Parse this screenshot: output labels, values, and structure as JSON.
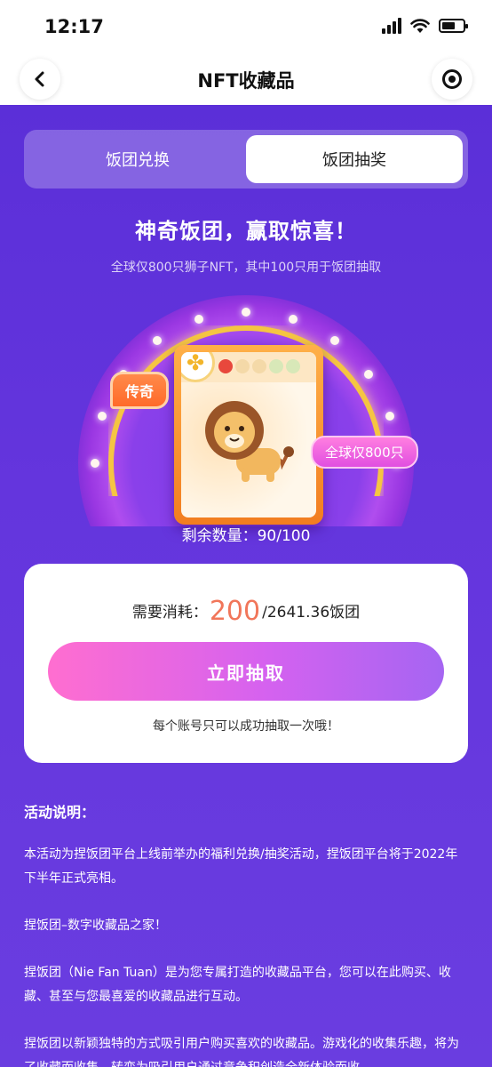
{
  "status": {
    "time": "12:17"
  },
  "nav": {
    "title": "NFT收藏品"
  },
  "tabs": [
    {
      "label": "饭团兑换",
      "active": false
    },
    {
      "label": "饭团抽奖",
      "active": true
    }
  ],
  "headline": "神奇饭团，赢取惊喜！",
  "subline": "全球仅800只狮子NFT，其中100只用于饭团抽取",
  "badges": {
    "rarity": "传奇",
    "limit": "全球仅800只"
  },
  "remaining": {
    "label": "剩余数量：",
    "value": "90/100"
  },
  "cost": {
    "label": "需要消耗：",
    "value": "200",
    "balance": "/2641.36饭团"
  },
  "draw_button": "立即抽取",
  "draw_note": "每个账号只可以成功抽取一次哦！",
  "description": {
    "title": "活动说明：",
    "paragraphs": [
      "本活动为捏饭团平台上线前举办的福利兑换/抽奖活动，捏饭团平台将于2022年下半年正式亮相。",
      "捏饭团–数字收藏品之家！",
      "捏饭团（Nie Fan Tuan）是为您专属打造的收藏品平台，您可以在此购买、收藏、甚至与您最喜爱的收藏品进行互动。",
      "捏饭团以新颖独特的方式吸引用户购买喜欢的收藏品。游戏化的收集乐趣，将为了收藏而收集，转变为吸引用户通过竞争积创造全新体验而收"
    ]
  },
  "colors": {
    "background": "#5a2fd6",
    "accent_pink": "#ff6ed0",
    "cost_value": "#f1765a",
    "card_orange": "#f27d20"
  },
  "icons": [
    "back-arrow-icon",
    "target-icon",
    "clover-icon",
    "lion-nft-image"
  ]
}
